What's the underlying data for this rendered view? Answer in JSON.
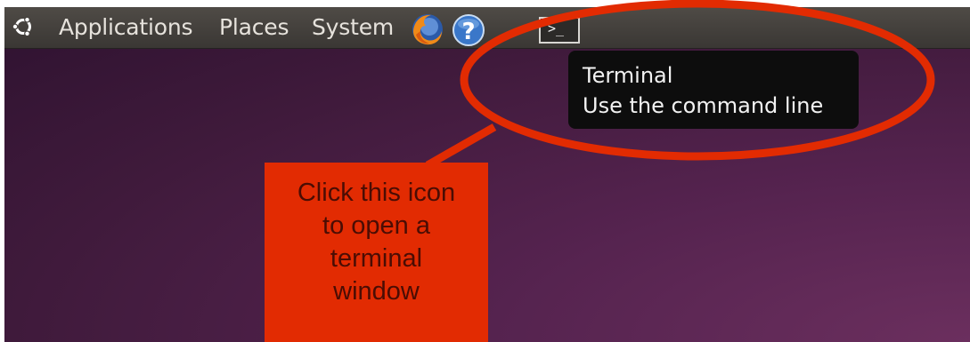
{
  "panel": {
    "menus": {
      "applications": "Applications",
      "places": "Places",
      "system": "System"
    },
    "icons": {
      "logo": "ubuntu-logo-icon",
      "firefox": "firefox-icon",
      "help": "help-icon",
      "terminal": "terminal-icon"
    },
    "terminal_prompt": ">_"
  },
  "tooltip": {
    "title": "Terminal",
    "description": "Use the command line"
  },
  "annotation": {
    "lines": [
      "Click this icon",
      "to open a",
      "terminal",
      "window"
    ],
    "color": "#e22b02"
  },
  "colors": {
    "panel": "#45413d",
    "wallpaper": "#4a1e45",
    "tooltip_bg": "#0d0d0d"
  }
}
